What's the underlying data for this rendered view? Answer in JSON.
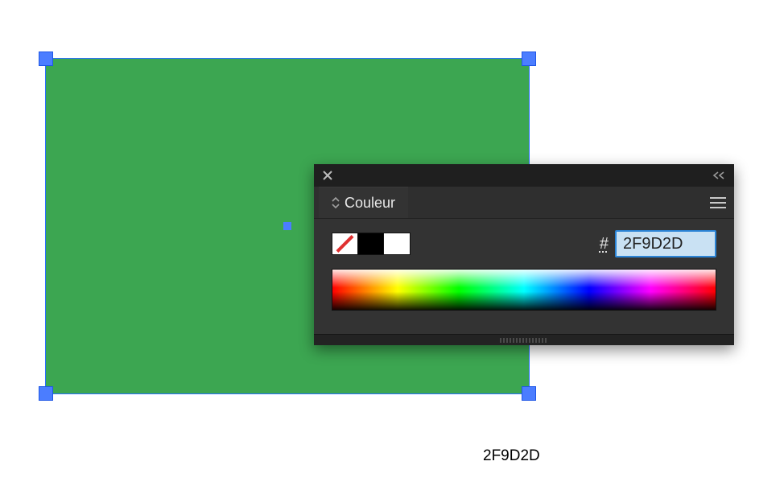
{
  "canvas": {
    "shape_fill": "#3CA651"
  },
  "panel": {
    "title": "Couleur",
    "hash_label": "#",
    "hex_value": "2F9D2D"
  },
  "caption": "2F9D2D"
}
